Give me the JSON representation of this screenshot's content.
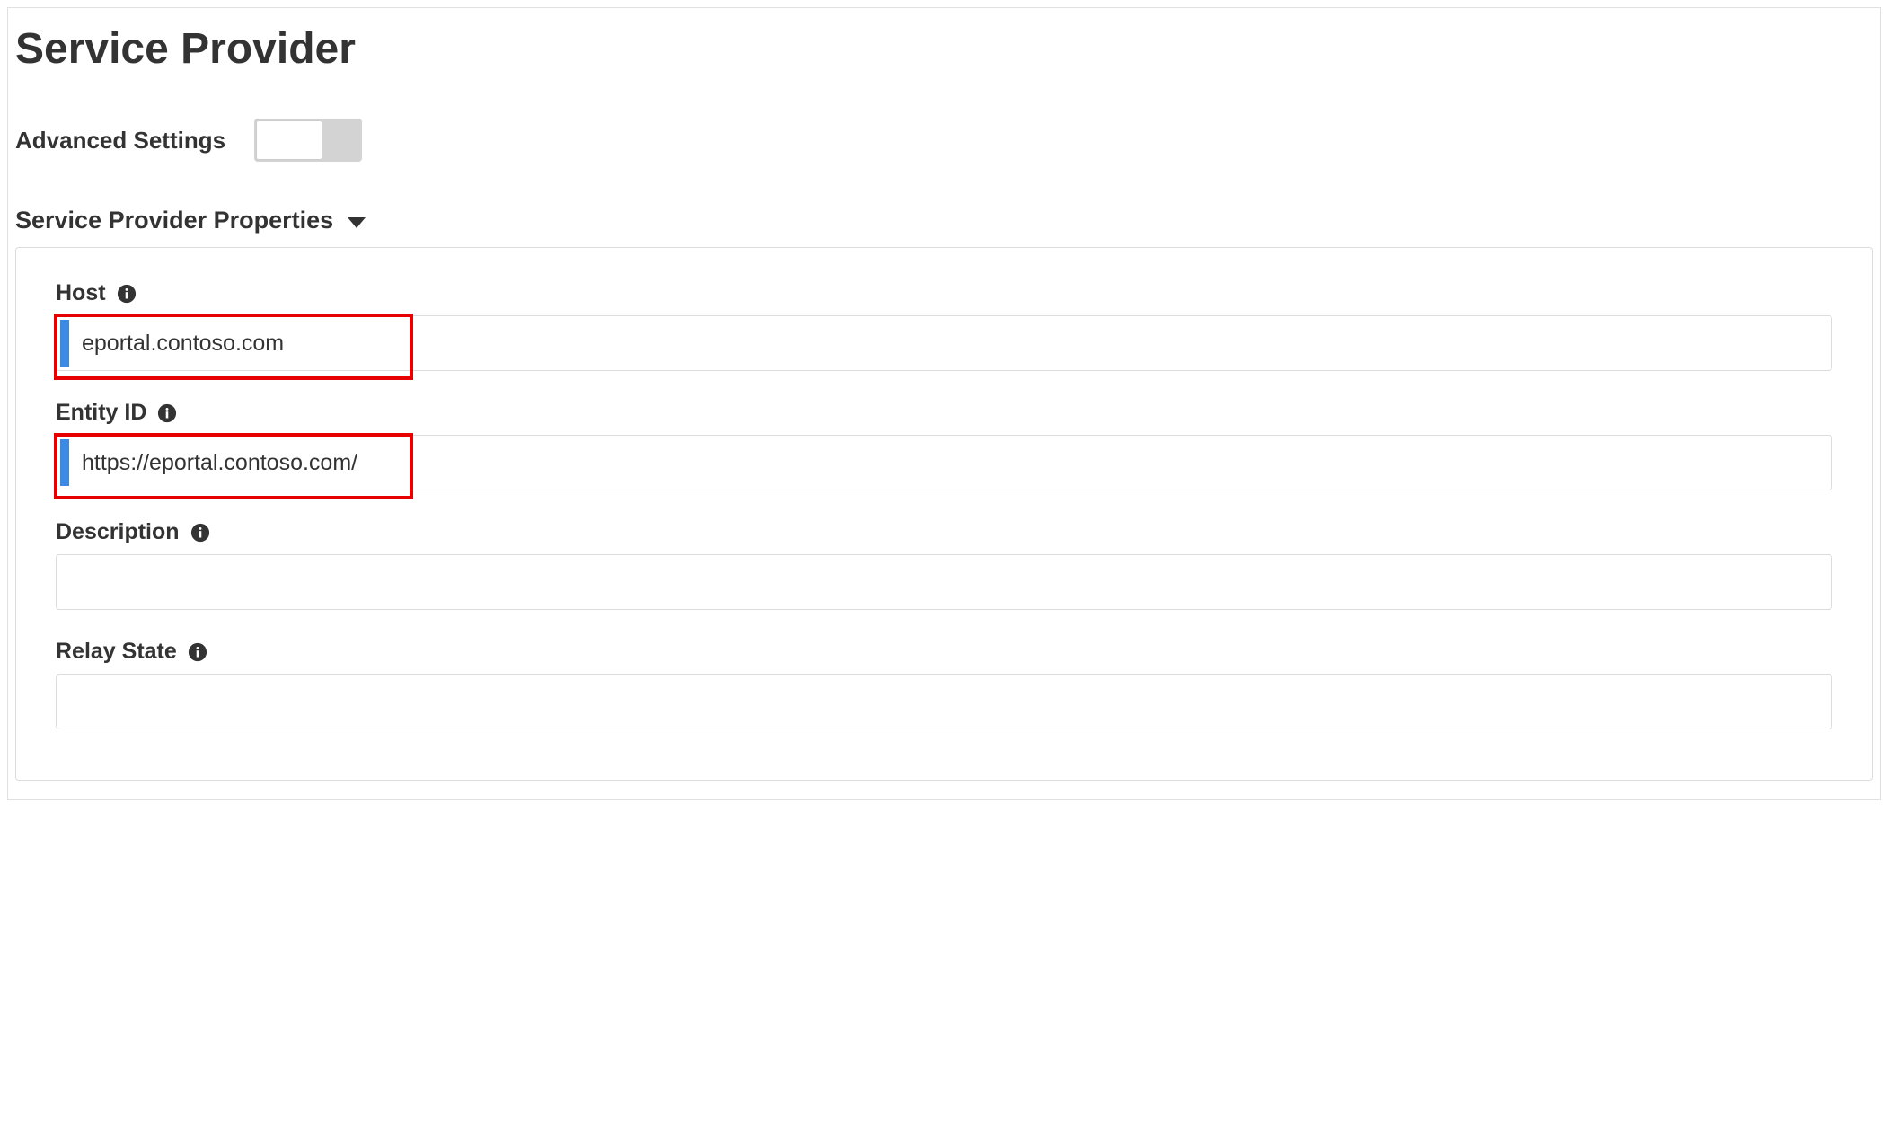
{
  "page": {
    "title": "Service Provider"
  },
  "advanced": {
    "label": "Advanced Settings",
    "enabled": false
  },
  "section": {
    "title": "Service Provider Properties"
  },
  "fields": {
    "host": {
      "label": "Host",
      "value": "eportal.contoso.com"
    },
    "entity_id": {
      "label": "Entity ID",
      "value": "https://eportal.contoso.com/"
    },
    "description": {
      "label": "Description",
      "value": ""
    },
    "relay_state": {
      "label": "Relay State",
      "value": ""
    }
  }
}
